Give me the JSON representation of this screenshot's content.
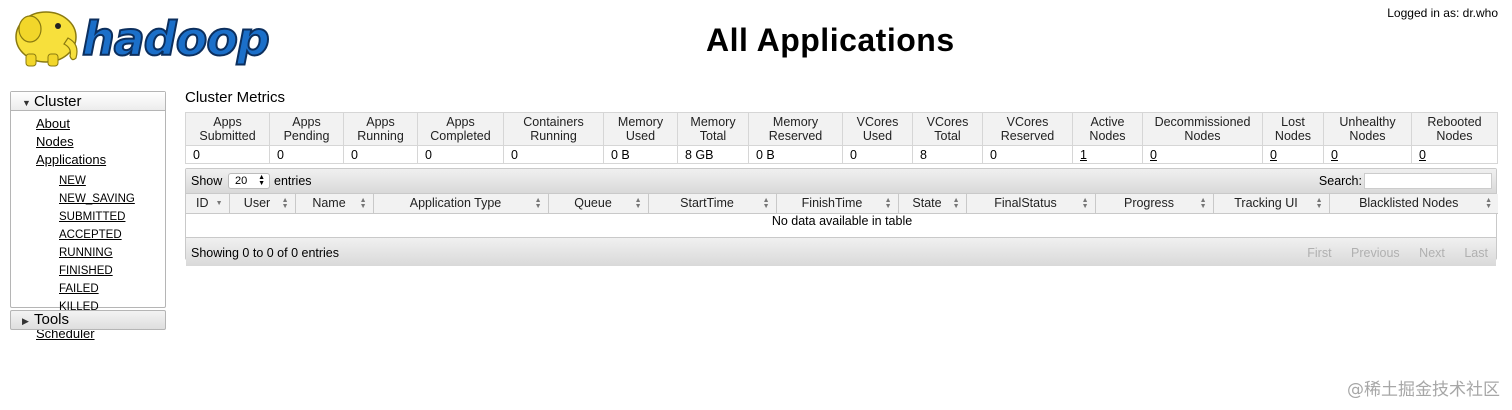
{
  "header": {
    "logo_text": "hadoop",
    "title": "All Applications",
    "logged_in": "Logged in as: dr.who"
  },
  "nav": {
    "cluster_label": "Cluster",
    "cluster_items": [
      "About",
      "Nodes",
      "Applications"
    ],
    "app_states": [
      "NEW",
      "NEW_SAVING",
      "SUBMITTED",
      "ACCEPTED",
      "RUNNING",
      "FINISHED",
      "FAILED",
      "KILLED"
    ],
    "scheduler": "Scheduler",
    "tools_label": "Tools"
  },
  "metrics": {
    "title": "Cluster Metrics",
    "headers": [
      [
        "Apps",
        "Submitted"
      ],
      [
        "Apps",
        "Pending"
      ],
      [
        "Apps",
        "Running"
      ],
      [
        "Apps",
        "Completed"
      ],
      [
        "Containers",
        "Running"
      ],
      [
        "Memory",
        "Used"
      ],
      [
        "Memory",
        "Total"
      ],
      [
        "Memory",
        "Reserved"
      ],
      [
        "VCores",
        "Used"
      ],
      [
        "VCores",
        "Total"
      ],
      [
        "VCores",
        "Reserved"
      ],
      [
        "Active",
        "Nodes"
      ],
      [
        "Decommissioned",
        "Nodes"
      ],
      [
        "Lost",
        "Nodes"
      ],
      [
        "Unhealthy",
        "Nodes"
      ],
      [
        "Rebooted",
        "Nodes"
      ]
    ],
    "values": [
      "0",
      "0",
      "0",
      "0",
      "0",
      "0 B",
      "8 GB",
      "0 B",
      "0",
      "8",
      "0",
      "1",
      "0",
      "0",
      "0",
      "0"
    ],
    "linked": [
      false,
      false,
      false,
      false,
      false,
      false,
      false,
      false,
      false,
      false,
      false,
      true,
      true,
      true,
      true,
      true
    ]
  },
  "apps": {
    "show_label": "Show",
    "page_length": "20",
    "entries_label": "entries",
    "search_label": "Search:",
    "search_value": "",
    "columns": [
      "ID",
      "User",
      "Name",
      "Application Type",
      "Queue",
      "StartTime",
      "FinishTime",
      "State",
      "FinalStatus",
      "Progress",
      "Tracking UI",
      "Blacklisted Nodes"
    ],
    "empty_message": "No data available in table",
    "info": "Showing 0 to 0 of 0 entries",
    "paginate": [
      "First",
      "Previous",
      "Next",
      "Last"
    ]
  },
  "watermark": "@稀土掘金技术社区",
  "colors": {
    "logo_yellow": "#f7e03c",
    "logo_blue": "#1b6fc9",
    "disabled_text": "#b0b0b0"
  }
}
